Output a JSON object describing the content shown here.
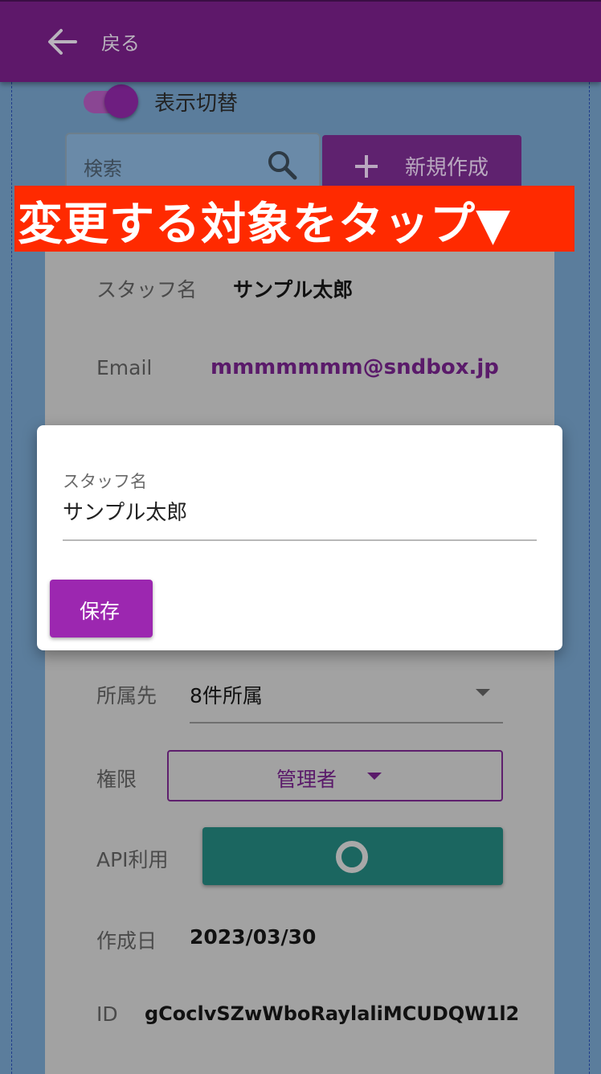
{
  "appbar": {
    "back_label": "戻る"
  },
  "toolbar": {
    "toggle_label": "表示切替",
    "search_placeholder": "検索",
    "new_label": "新規作成"
  },
  "banner": {
    "text": "変更する対象をタップ▼"
  },
  "detail": {
    "staff_name_label": "スタッフ名",
    "staff_name_value": "サンプル太郎",
    "email_label": "Email",
    "email_value": "mmmmmmm@sndbox.jp",
    "affiliation_label": "所属先",
    "affiliation_value": "8件所属",
    "role_label": "権限",
    "role_value": "管理者",
    "api_label": "API利用",
    "created_label": "作成日",
    "created_value": "2023/03/30",
    "id_label": "ID",
    "id_value": "gCoclvSZwWboRaylaliMCUDQW1l2"
  },
  "modal": {
    "field_label": "スタッフ名",
    "field_value": "サンプル太郎",
    "save_label": "保存"
  },
  "colors": {
    "appbar": "#5e186a",
    "banner": "#ff2a00",
    "save_button": "#9c27b0",
    "api_button": "#1b6660"
  },
  "icons": [
    "back-arrow-icon",
    "search-icon",
    "plus-icon",
    "chevron-down-icon",
    "ring-icon"
  ]
}
